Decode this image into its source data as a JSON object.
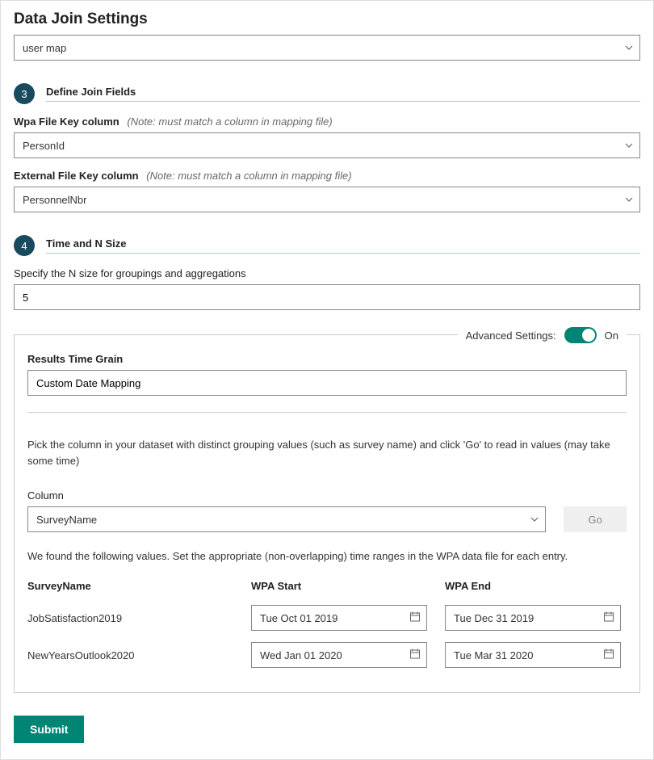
{
  "page_title": "Data Join Settings",
  "top_select_value": "user map",
  "step3": {
    "badge": "3",
    "title": "Define Join Fields",
    "wpa_label": "Wpa File Key column",
    "wpa_note": "(Note: must match a column in mapping file)",
    "wpa_value": "PersonId",
    "ext_label": "External File Key column",
    "ext_note": "(Note: must match a column in mapping file)",
    "ext_value": "PersonnelNbr"
  },
  "step4": {
    "badge": "4",
    "title": "Time and N Size",
    "nsize_label": "Specify the N size for groupings and aggregations",
    "nsize_value": "5"
  },
  "panel": {
    "legend_label": "Advanced Settings:",
    "toggle_state": "On",
    "results_label": "Results Time Grain",
    "results_value": "Custom Date Mapping",
    "instructions": "Pick the column in your dataset with distinct grouping values (such as survey name) and click 'Go' to read in values (may take some time)",
    "column_label": "Column",
    "column_value": "SurveyName",
    "go_label": "Go",
    "found_text": "We found the following values. Set the appropriate (non-overlapping) time ranges in the WPA data file for each entry.",
    "th_name": "SurveyName",
    "th_start": "WPA Start",
    "th_end": "WPA End",
    "rows": [
      {
        "name": "JobSatisfaction2019",
        "start": "Tue Oct 01 2019",
        "end": "Tue Dec 31 2019"
      },
      {
        "name": "NewYearsOutlook2020",
        "start": "Wed Jan 01 2020",
        "end": "Tue Mar 31 2020"
      }
    ]
  },
  "submit_label": "Submit"
}
